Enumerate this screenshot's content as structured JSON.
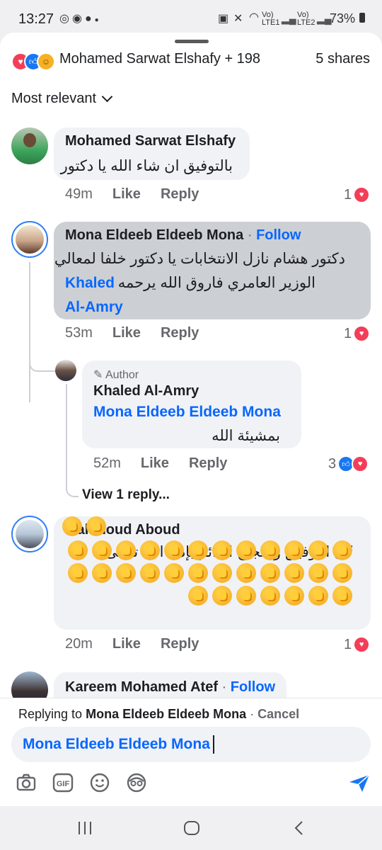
{
  "status_bar": {
    "time": "13:27",
    "left_icons": [
      "whatsapp-icon",
      "app-icon",
      "chat-icon",
      "dot-icon"
    ],
    "signal1_label": "Vo) LTE1",
    "signal2_label": "Vo) LTE2",
    "battery": "73%"
  },
  "header": {
    "reactions": [
      "love",
      "like",
      "care"
    ],
    "names": "Mohamed Sarwat Elshafy + 198",
    "shares": "5 shares"
  },
  "sort": {
    "label": "Most relevant"
  },
  "comments": [
    {
      "author": "Mohamed Sarwat Elshafy",
      "text": "بالتوفيق ان شاء الله يا دكتور",
      "time": "49m",
      "like": "Like",
      "reply": "Reply",
      "count": "1"
    },
    {
      "author": "Mona Eldeeb Eldeeb Mona",
      "follow": "Follow",
      "dot": "·",
      "text_line1": "دكتور هشام نازل الانتخابات يا دكتور خلفا لمعالي",
      "text_line2": "الوزير  العامري فاروق الله يرحمه",
      "mention_part1": "Khaled",
      "mention_part2": "Al-Amry",
      "time": "53m",
      "like": "Like",
      "reply": "Reply",
      "count": "1"
    },
    {
      "badge": "Author",
      "author": "Khaled Al-Amry",
      "mention": "Mona Eldeeb Eldeeb Mona",
      "text": "بمشيئة الله",
      "time": "52m",
      "like": "Like",
      "reply": "Reply",
      "count": "3"
    },
    {
      "view_replies": "View 1 reply..."
    },
    {
      "author": "Mahmoud Aboud",
      "text": "كل التوفيق والنجاح الدائم بإذن الله تعالى",
      "clap_count": 33,
      "time": "20m",
      "like": "Like",
      "reply": "Reply",
      "count": "1"
    },
    {
      "author": "Kareem Mohamed Atef",
      "dot": "·",
      "follow": "Follow"
    }
  ],
  "composer": {
    "replying_prefix": "Replying to",
    "replying_name": "Mona Eldeeb Eldeeb Mona",
    "separator": "·",
    "cancel": "Cancel",
    "input_value": "Mona Eldeeb Eldeeb Mona",
    "tools": [
      "camera-icon",
      "gif-icon",
      "emoji-icon",
      "avatar-sticker-icon"
    ]
  },
  "colors": {
    "accent": "#0866ff",
    "love": "#f33e58",
    "like": "#1877f2",
    "bubble": "#f0f2f5",
    "highlight_bubble": "#ccd0d5"
  }
}
